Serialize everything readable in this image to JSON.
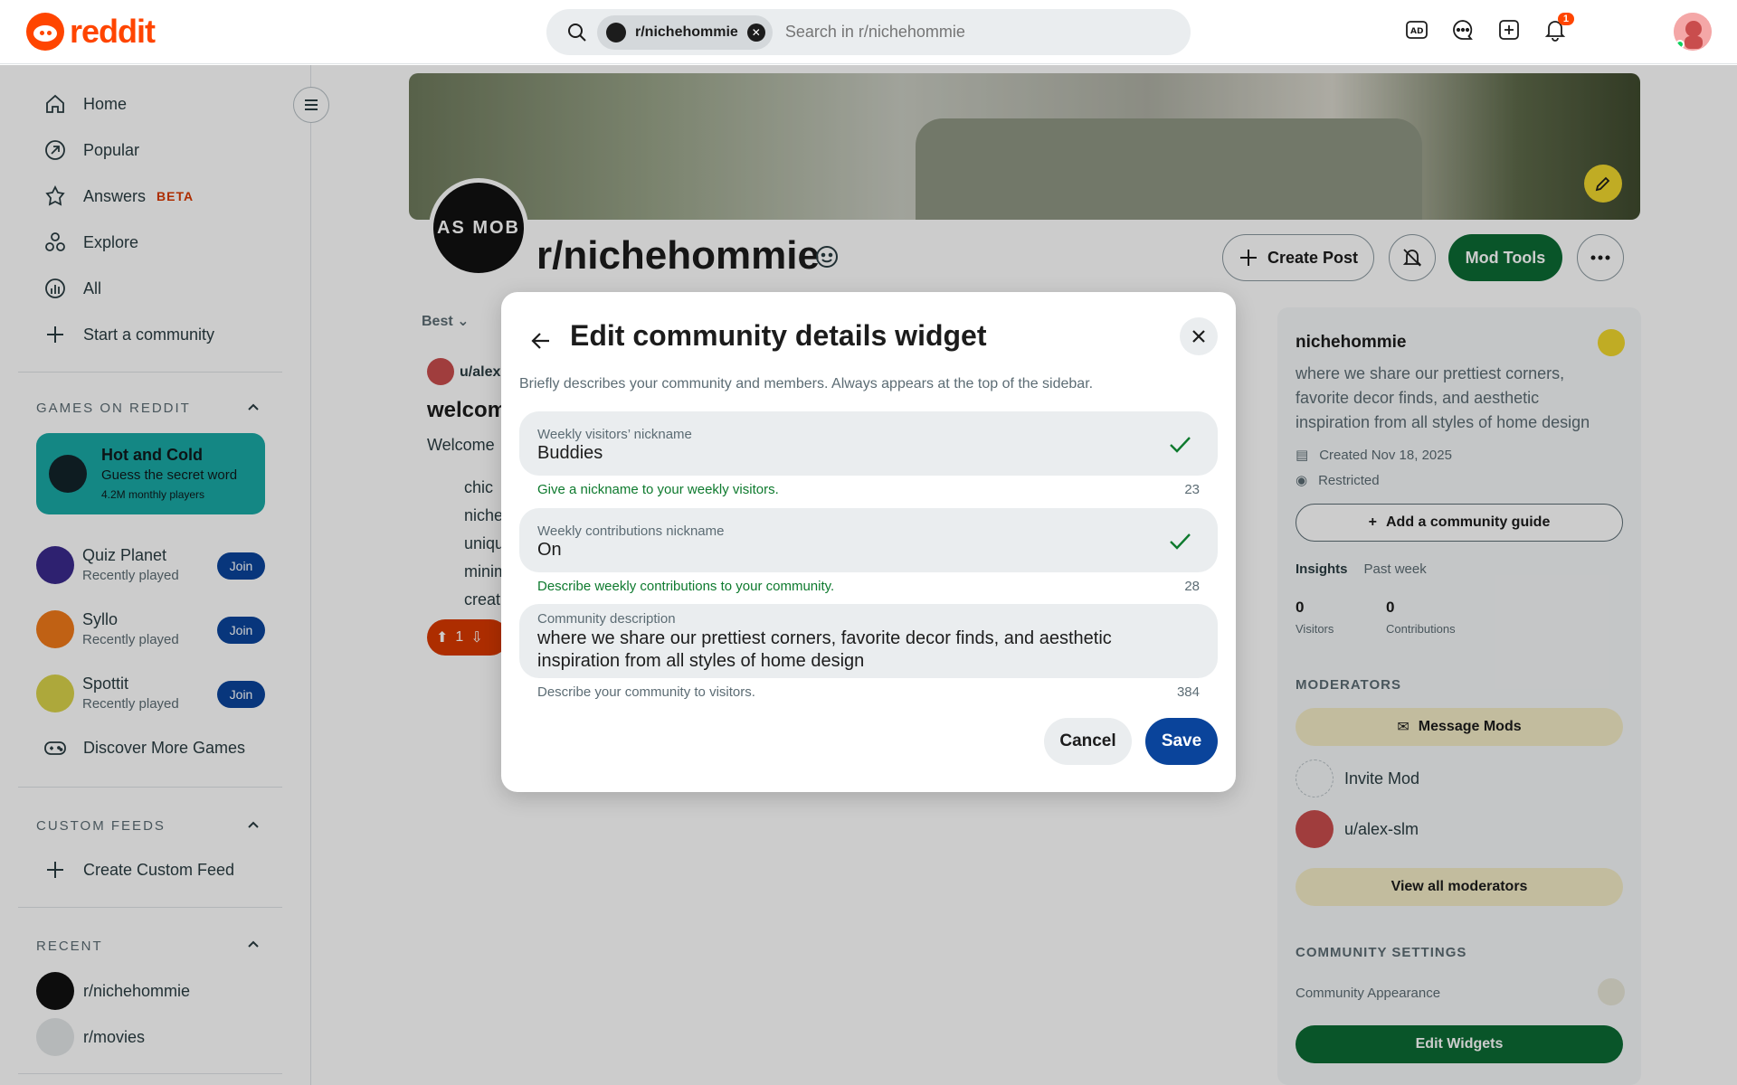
{
  "header": {
    "logo_text": "reddit",
    "search_chip": "r/nichehommie",
    "search_placeholder": "Search in r/nichehommie",
    "notification_count": "1",
    "icons": [
      "advertise-icon",
      "chat-icon",
      "create-post-icon",
      "notification-icon"
    ]
  },
  "sidebar": {
    "nav": [
      {
        "label": "Home",
        "icon": "home-icon"
      },
      {
        "label": "Popular",
        "icon": "popular-icon"
      },
      {
        "label": "Answers",
        "icon": "answers-icon",
        "badge": "BETA"
      },
      {
        "label": "Explore",
        "icon": "explore-icon"
      },
      {
        "label": "All",
        "icon": "all-icon"
      },
      {
        "label": "Start a community",
        "icon": "plus-icon"
      }
    ],
    "games_title": "GAMES ON REDDIT",
    "featured_game": {
      "title": "Hot and Cold",
      "subtitle": "Guess the secret word",
      "players": "4.2M monthly players"
    },
    "games": [
      {
        "name": "Quiz Planet",
        "sub": "Recently played",
        "join": "Join",
        "color": "#3a2a8c"
      },
      {
        "name": "Syllo",
        "sub": "Recently played",
        "join": "Join",
        "color": "#f07a1a"
      },
      {
        "name": "Spottit",
        "sub": "Recently played",
        "join": "Join",
        "color": "#d9d24a"
      }
    ],
    "discover": "Discover More Games",
    "custom_feeds_title": "CUSTOM FEEDS",
    "create_feed": "Create Custom Feed",
    "recent_title": "RECENT",
    "recent": [
      {
        "name": "r/nichehommie"
      },
      {
        "name": "r/movies"
      }
    ]
  },
  "community": {
    "name": "r/nichehommie",
    "avatar_text": "AS MOB",
    "create_post": "Create Post",
    "mod_tools": "Mod Tools",
    "sort": "Best",
    "post_user": "u/alex",
    "post_title": "welcom",
    "post_body": "Welcome",
    "bullets": [
      "chic",
      "niche",
      "uniqu",
      "minim",
      "creat"
    ],
    "vote_count": "1"
  },
  "right_panel": {
    "title": "nichehommie",
    "description": "where we share our prettiest corners, favorite decor finds, and aesthetic inspiration from all styles of home design",
    "created": "Created Nov 18, 2025",
    "visibility": "Restricted",
    "add_guide": "Add a community guide",
    "insights": "Insights",
    "insights_range": "Past week",
    "visitors_n": "0",
    "visitors_l": "Visitors",
    "contributions_n": "0",
    "contributions_l": "Contributions",
    "moderators_title": "MODERATORS",
    "message_mods": "Message Mods",
    "invite_mod": "Invite Mod",
    "moderator": "u/alex-slm",
    "view_all": "View all moderators",
    "settings_title": "COMMUNITY SETTINGS",
    "appearance": "Community Appearance",
    "edit_widgets": "Edit Widgets"
  },
  "modal": {
    "title": "Edit community details widget",
    "subtitle": "Briefly describes your community and members. Always appears at the top of the sidebar.",
    "fields": [
      {
        "label": "Weekly visitors’ nickname",
        "value": "Buddies",
        "helper": "Give a nickname to your weekly visitors.",
        "count": "23"
      },
      {
        "label": "Weekly contributions nickname",
        "value": "On",
        "helper": "Describe weekly contributions to your community.",
        "count": "28"
      },
      {
        "label": "Community description",
        "value": "where we share our prettiest corners, favorite decor finds, and aesthetic inspiration from all styles of home design",
        "helper": "Describe your community to visitors.",
        "count": "384"
      }
    ],
    "cancel": "Cancel",
    "save": "Save"
  },
  "colors": {
    "brand": "#ff4500",
    "valid_green": "#0e7a2e",
    "save_blue": "#0a449b",
    "mod_green": "#0c6b34"
  }
}
